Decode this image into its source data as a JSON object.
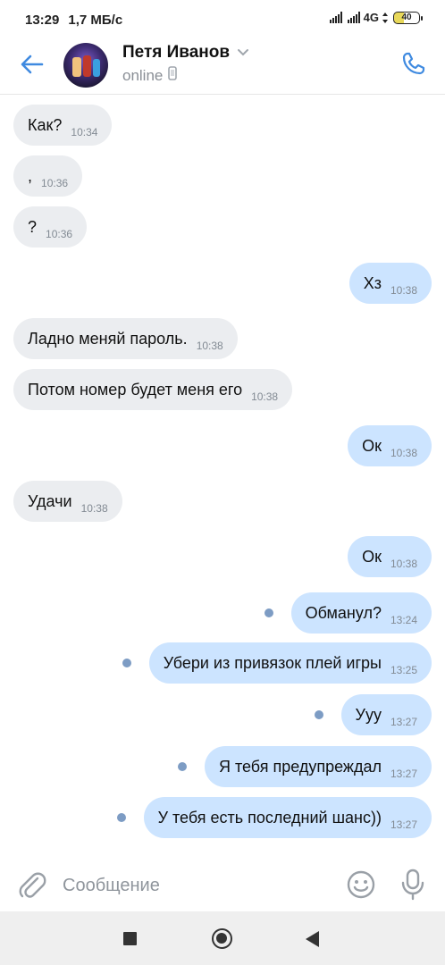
{
  "status_bar": {
    "time": "13:29",
    "speed": "1,7 МБ/с",
    "network": "4G",
    "battery": "40"
  },
  "header": {
    "contact_name": "Петя Иванов",
    "status": "online",
    "icons": [
      "back-arrow-icon",
      "phone-icon",
      "chevron-down-icon",
      "mobile-device-icon"
    ]
  },
  "messages": [
    {
      "dir": "in",
      "text": "Как?",
      "time": "10:34"
    },
    {
      "dir": "in",
      "text": ",",
      "time": "10:36"
    },
    {
      "dir": "in",
      "text": "?",
      "time": "10:36"
    },
    {
      "dir": "out",
      "text": "Хз",
      "time": "10:38",
      "unread": false
    },
    {
      "dir": "in",
      "text": "Ладно меняй пароль.",
      "time": "10:38"
    },
    {
      "dir": "in",
      "text": "Потом номер будет меня его",
      "time": "10:38"
    },
    {
      "dir": "out",
      "text": "Ок",
      "time": "10:38",
      "unread": false
    },
    {
      "dir": "in",
      "text": "Удачи",
      "time": "10:38"
    },
    {
      "dir": "out",
      "text": "Ок",
      "time": "10:38",
      "unread": false
    },
    {
      "dir": "out",
      "text": "Обманул?",
      "time": "13:24",
      "unread": true
    },
    {
      "dir": "out",
      "text": "Убери из привязок плей игры",
      "time": "13:25",
      "unread": true
    },
    {
      "dir": "out",
      "text": "Ууу",
      "time": "13:27",
      "unread": true
    },
    {
      "dir": "out",
      "text": "Я тебя предупреждал",
      "time": "13:27",
      "unread": true
    },
    {
      "dir": "out",
      "text": "У тебя есть последний шанс))",
      "time": "13:27",
      "unread": true
    }
  ],
  "composer": {
    "placeholder": "Сообщение",
    "icons": [
      "attach-icon",
      "emoji-icon",
      "microphone-icon"
    ]
  },
  "colors": {
    "accent": "#3f8ae0",
    "incoming_bubble": "#ebedf0",
    "outgoing_bubble": "#cce4ff",
    "unread_dot": "#7d9cc4"
  }
}
